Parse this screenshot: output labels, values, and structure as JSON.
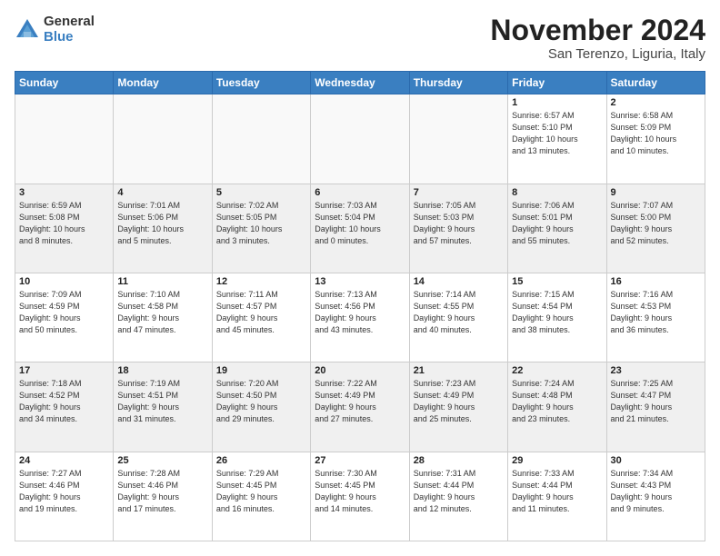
{
  "logo": {
    "general": "General",
    "blue": "Blue"
  },
  "header": {
    "month": "November 2024",
    "location": "San Terenzo, Liguria, Italy"
  },
  "weekdays": [
    "Sunday",
    "Monday",
    "Tuesday",
    "Wednesday",
    "Thursday",
    "Friday",
    "Saturday"
  ],
  "weeks": [
    [
      {
        "day": "",
        "info": ""
      },
      {
        "day": "",
        "info": ""
      },
      {
        "day": "",
        "info": ""
      },
      {
        "day": "",
        "info": ""
      },
      {
        "day": "",
        "info": ""
      },
      {
        "day": "1",
        "info": "Sunrise: 6:57 AM\nSunset: 5:10 PM\nDaylight: 10 hours\nand 13 minutes."
      },
      {
        "day": "2",
        "info": "Sunrise: 6:58 AM\nSunset: 5:09 PM\nDaylight: 10 hours\nand 10 minutes."
      }
    ],
    [
      {
        "day": "3",
        "info": "Sunrise: 6:59 AM\nSunset: 5:08 PM\nDaylight: 10 hours\nand 8 minutes."
      },
      {
        "day": "4",
        "info": "Sunrise: 7:01 AM\nSunset: 5:06 PM\nDaylight: 10 hours\nand 5 minutes."
      },
      {
        "day": "5",
        "info": "Sunrise: 7:02 AM\nSunset: 5:05 PM\nDaylight: 10 hours\nand 3 minutes."
      },
      {
        "day": "6",
        "info": "Sunrise: 7:03 AM\nSunset: 5:04 PM\nDaylight: 10 hours\nand 0 minutes."
      },
      {
        "day": "7",
        "info": "Sunrise: 7:05 AM\nSunset: 5:03 PM\nDaylight: 9 hours\nand 57 minutes."
      },
      {
        "day": "8",
        "info": "Sunrise: 7:06 AM\nSunset: 5:01 PM\nDaylight: 9 hours\nand 55 minutes."
      },
      {
        "day": "9",
        "info": "Sunrise: 7:07 AM\nSunset: 5:00 PM\nDaylight: 9 hours\nand 52 minutes."
      }
    ],
    [
      {
        "day": "10",
        "info": "Sunrise: 7:09 AM\nSunset: 4:59 PM\nDaylight: 9 hours\nand 50 minutes."
      },
      {
        "day": "11",
        "info": "Sunrise: 7:10 AM\nSunset: 4:58 PM\nDaylight: 9 hours\nand 47 minutes."
      },
      {
        "day": "12",
        "info": "Sunrise: 7:11 AM\nSunset: 4:57 PM\nDaylight: 9 hours\nand 45 minutes."
      },
      {
        "day": "13",
        "info": "Sunrise: 7:13 AM\nSunset: 4:56 PM\nDaylight: 9 hours\nand 43 minutes."
      },
      {
        "day": "14",
        "info": "Sunrise: 7:14 AM\nSunset: 4:55 PM\nDaylight: 9 hours\nand 40 minutes."
      },
      {
        "day": "15",
        "info": "Sunrise: 7:15 AM\nSunset: 4:54 PM\nDaylight: 9 hours\nand 38 minutes."
      },
      {
        "day": "16",
        "info": "Sunrise: 7:16 AM\nSunset: 4:53 PM\nDaylight: 9 hours\nand 36 minutes."
      }
    ],
    [
      {
        "day": "17",
        "info": "Sunrise: 7:18 AM\nSunset: 4:52 PM\nDaylight: 9 hours\nand 34 minutes."
      },
      {
        "day": "18",
        "info": "Sunrise: 7:19 AM\nSunset: 4:51 PM\nDaylight: 9 hours\nand 31 minutes."
      },
      {
        "day": "19",
        "info": "Sunrise: 7:20 AM\nSunset: 4:50 PM\nDaylight: 9 hours\nand 29 minutes."
      },
      {
        "day": "20",
        "info": "Sunrise: 7:22 AM\nSunset: 4:49 PM\nDaylight: 9 hours\nand 27 minutes."
      },
      {
        "day": "21",
        "info": "Sunrise: 7:23 AM\nSunset: 4:49 PM\nDaylight: 9 hours\nand 25 minutes."
      },
      {
        "day": "22",
        "info": "Sunrise: 7:24 AM\nSunset: 4:48 PM\nDaylight: 9 hours\nand 23 minutes."
      },
      {
        "day": "23",
        "info": "Sunrise: 7:25 AM\nSunset: 4:47 PM\nDaylight: 9 hours\nand 21 minutes."
      }
    ],
    [
      {
        "day": "24",
        "info": "Sunrise: 7:27 AM\nSunset: 4:46 PM\nDaylight: 9 hours\nand 19 minutes."
      },
      {
        "day": "25",
        "info": "Sunrise: 7:28 AM\nSunset: 4:46 PM\nDaylight: 9 hours\nand 17 minutes."
      },
      {
        "day": "26",
        "info": "Sunrise: 7:29 AM\nSunset: 4:45 PM\nDaylight: 9 hours\nand 16 minutes."
      },
      {
        "day": "27",
        "info": "Sunrise: 7:30 AM\nSunset: 4:45 PM\nDaylight: 9 hours\nand 14 minutes."
      },
      {
        "day": "28",
        "info": "Sunrise: 7:31 AM\nSunset: 4:44 PM\nDaylight: 9 hours\nand 12 minutes."
      },
      {
        "day": "29",
        "info": "Sunrise: 7:33 AM\nSunset: 4:44 PM\nDaylight: 9 hours\nand 11 minutes."
      },
      {
        "day": "30",
        "info": "Sunrise: 7:34 AM\nSunset: 4:43 PM\nDaylight: 9 hours\nand 9 minutes."
      }
    ]
  ]
}
